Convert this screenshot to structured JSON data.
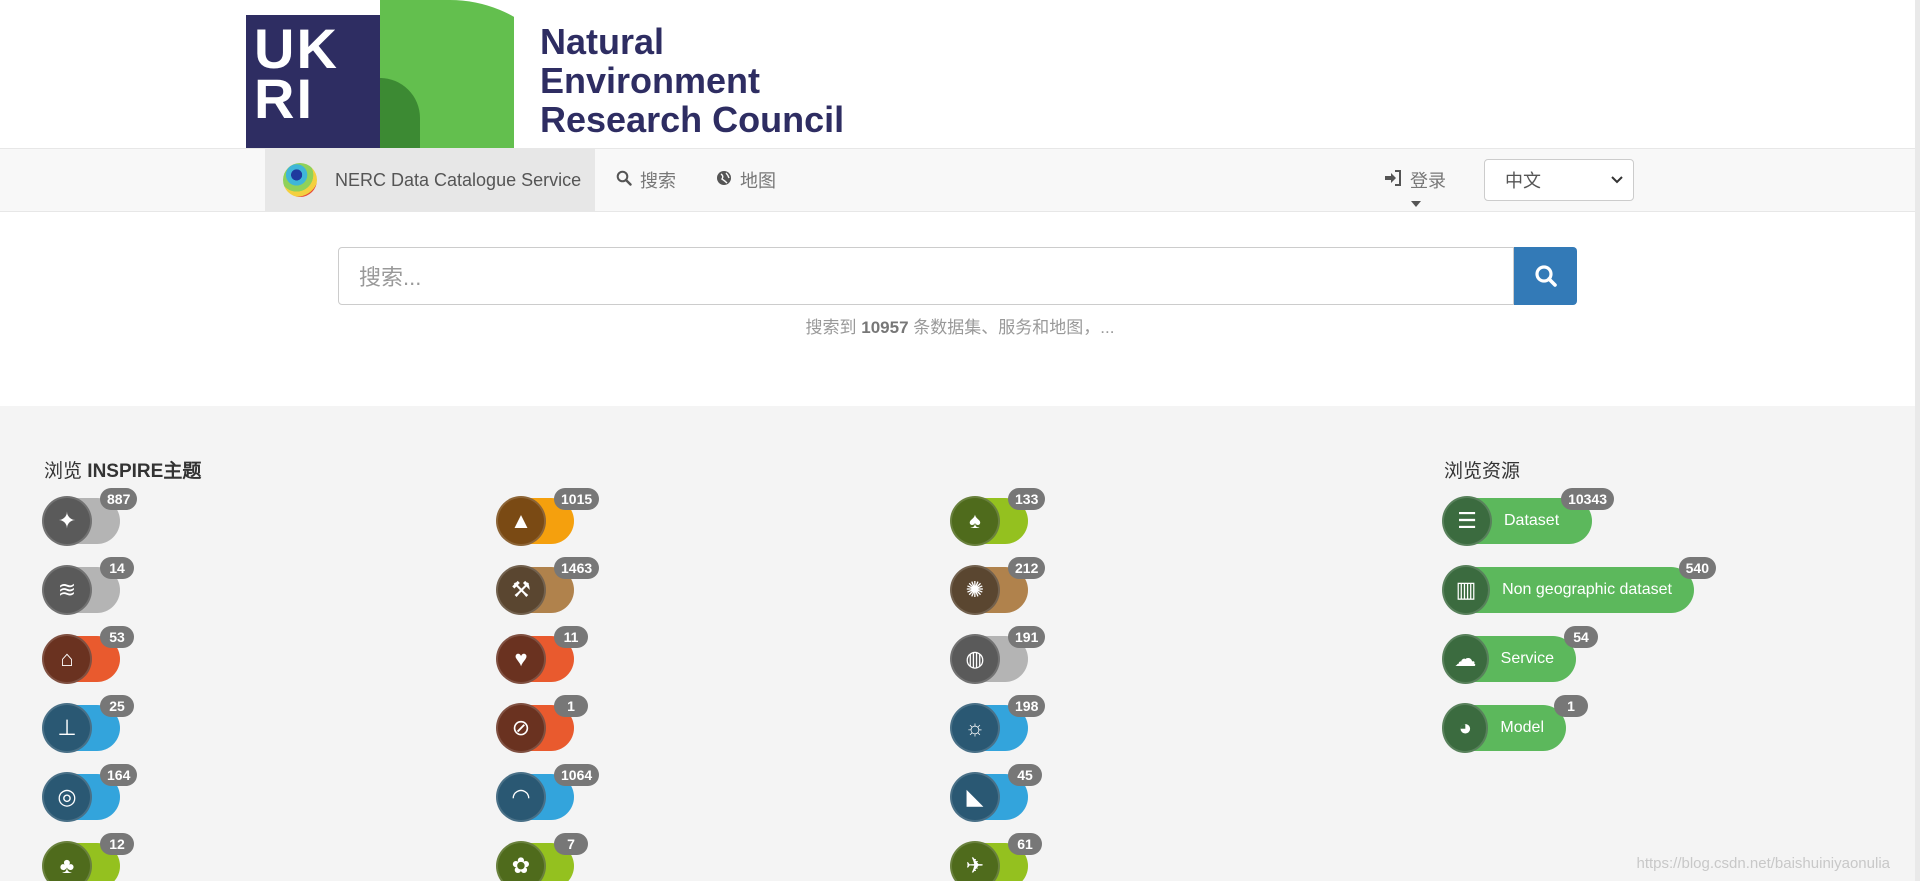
{
  "logo": {
    "ukri_letters": "UK RI",
    "org_line1": "Natural",
    "org_line2": "Environment",
    "org_line3": "Research Council"
  },
  "navbar": {
    "brand": "NERC Data Catalogue Service",
    "search": "搜索",
    "map": "地图",
    "login": "登录",
    "language": "中文"
  },
  "search": {
    "placeholder": "搜索...",
    "hint_prefix": "搜索到",
    "hint_count": "10957",
    "hint_suffix": "条数据集、服务和地图，..."
  },
  "inspire": {
    "title_prefix": "浏览",
    "title_bold": "INSPIRE主题",
    "columns": [
      [
        {
          "icon": "coordinate-reference-icon",
          "count": "887",
          "colors": [
            "#5a5a5a",
            "#b4b4b4"
          ]
        },
        {
          "icon": "land-cover-icon",
          "count": "14",
          "colors": [
            "#5a5a5a",
            "#b4b4b4"
          ]
        },
        {
          "icon": "buildings-icon",
          "count": "53",
          "colors": [
            "#6a3220",
            "#e95a2e"
          ]
        },
        {
          "icon": "utility-services-icon",
          "count": "25",
          "colors": [
            "#2a5873",
            "#33a4dc"
          ]
        },
        {
          "icon": "oceanographic-icon",
          "count": "164",
          "colors": [
            "#2a5873",
            "#33a4dc"
          ]
        },
        {
          "icon": "habitats-icon",
          "count": "12",
          "colors": [
            "#4f6b1c",
            "#94c11f"
          ]
        }
      ],
      [
        {
          "icon": "elevation-icon",
          "count": "1015",
          "colors": [
            "#7a4a14",
            "#f5a00d"
          ]
        },
        {
          "icon": "mineral-resources-icon",
          "count": "1463",
          "colors": [
            "#5a4630",
            "#b0824c"
          ]
        },
        {
          "icon": "human-health-icon",
          "count": "11",
          "colors": [
            "#6a3220",
            "#e95a2e"
          ]
        },
        {
          "icon": "hazard-zones-icon",
          "count": "1",
          "colors": [
            "#6a3220",
            "#e95a2e"
          ]
        },
        {
          "icon": "sea-regions-icon",
          "count": "1064",
          "colors": [
            "#2a5873",
            "#33a4dc"
          ]
        },
        {
          "icon": "species-distribution-icon",
          "count": "7",
          "colors": [
            "#4f6b1c",
            "#94c11f"
          ]
        }
      ],
      [
        {
          "icon": "protected-sites-icon",
          "count": "133",
          "colors": [
            "#4f6b1c",
            "#94c11f"
          ]
        },
        {
          "icon": "soil-icon",
          "count": "212",
          "colors": [
            "#5a4630",
            "#b0824c"
          ]
        },
        {
          "icon": "geographical-grid-icon",
          "count": "191",
          "colors": [
            "#5a5a5a",
            "#b4b4b4"
          ]
        },
        {
          "icon": "atmospheric-conditions-icon",
          "count": "198",
          "colors": [
            "#2a5873",
            "#33a4dc"
          ]
        },
        {
          "icon": "hydrography-icon",
          "count": "45",
          "colors": [
            "#2a5873",
            "#33a4dc"
          ]
        },
        {
          "icon": "bio-geographical-icon",
          "count": "61",
          "colors": [
            "#4f6b1c",
            "#94c11f"
          ]
        }
      ]
    ]
  },
  "resources": {
    "title": "浏览资源",
    "items": [
      {
        "icon": "database-icon",
        "label": "Dataset",
        "count": "10343",
        "glyph": "☰"
      },
      {
        "icon": "bar-chart-icon",
        "label": "Non geographic dataset",
        "count": "540",
        "glyph": "▥"
      },
      {
        "icon": "cloud-icon",
        "label": "Service",
        "count": "54",
        "glyph": "☁"
      },
      {
        "icon": "dashboard-icon",
        "label": "Model",
        "count": "1",
        "glyph": "◕"
      }
    ],
    "colors": [
      "#3b6b3f",
      "#5cb85c"
    ]
  },
  "watermark": "https://blog.csdn.net/baishuiniyaonulia"
}
